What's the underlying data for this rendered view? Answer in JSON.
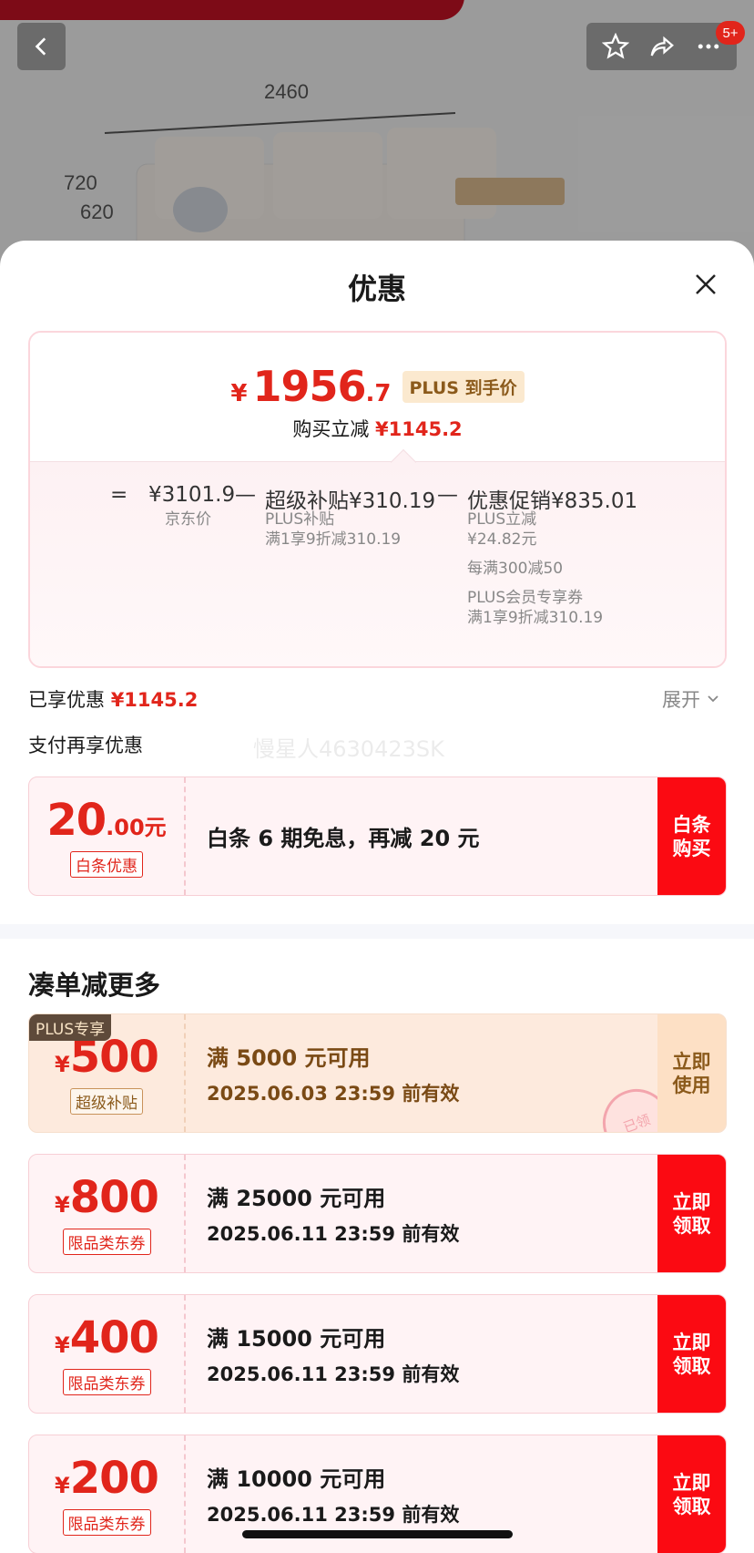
{
  "background": {
    "dimensions": {
      "width_label": "2460",
      "height_label_1": "720",
      "height_label_2": "620"
    },
    "cart_badge": "5+",
    "icons": [
      "back-arrow-icon",
      "star-icon",
      "share-icon",
      "more-icon"
    ]
  },
  "sheet": {
    "title": "优惠"
  },
  "price": {
    "currency": "¥",
    "final_int": "1956",
    "final_dec": ".7",
    "plus_tag": "PLUS 到手价",
    "reduce_label": "购买立减",
    "reduce_value": "¥1145.2",
    "equation": {
      "eq": "=",
      "jd_price": "¥3101.9",
      "jd_price_label": "京东价",
      "minus1": "—",
      "subsidy": "超级补贴¥310.19",
      "subsidy_sub1": "PLUS补贴",
      "subsidy_sub2": "满1享9折减310.19",
      "minus2": "—",
      "promo": "优惠促销¥835.01",
      "promo_sub1": "PLUS立减",
      "promo_sub2": "¥24.82元",
      "promo_sub3": "每满300减50",
      "promo_sub4": "PLUS会员专享券",
      "promo_sub5": "满1享9折减310.19"
    }
  },
  "enjoyed": {
    "label": "已享优惠",
    "value": "¥1145.2",
    "expand": "展开"
  },
  "pay": {
    "title": "支付再享优惠",
    "watermark": "慢星人4630423SK"
  },
  "baitiao": {
    "amount_int": "20",
    "amount_dec": ".00",
    "amount_unit": "元",
    "tag": "白条优惠",
    "desc": "白条 6 期免息，再减 20 元",
    "button": "白条购买"
  },
  "more": {
    "title": "凑单减更多"
  },
  "coupons": [
    {
      "plus_label": "PLUS专享",
      "yen": "¥",
      "amount": "500",
      "tag": "超级补贴",
      "line1": "满 5000 元可用",
      "line2": "2025.06.03 23:59 前有效",
      "button": "立即使用",
      "stamp": "已领"
    },
    {
      "yen": "¥",
      "amount": "800",
      "tag": "限品类东券",
      "line1": "满 25000 元可用",
      "line2": "2025.06.11 23:59 前有效",
      "button": "立即领取"
    },
    {
      "yen": "¥",
      "amount": "400",
      "tag": "限品类东券",
      "line1": "满 15000 元可用",
      "line2": "2025.06.11 23:59 前有效",
      "button": "立即领取"
    },
    {
      "yen": "¥",
      "amount": "200",
      "tag": "限品类东券",
      "line1": "满 10000 元可用",
      "line2": "2025.06.11 23:59 前有效",
      "button": "立即领取"
    }
  ]
}
